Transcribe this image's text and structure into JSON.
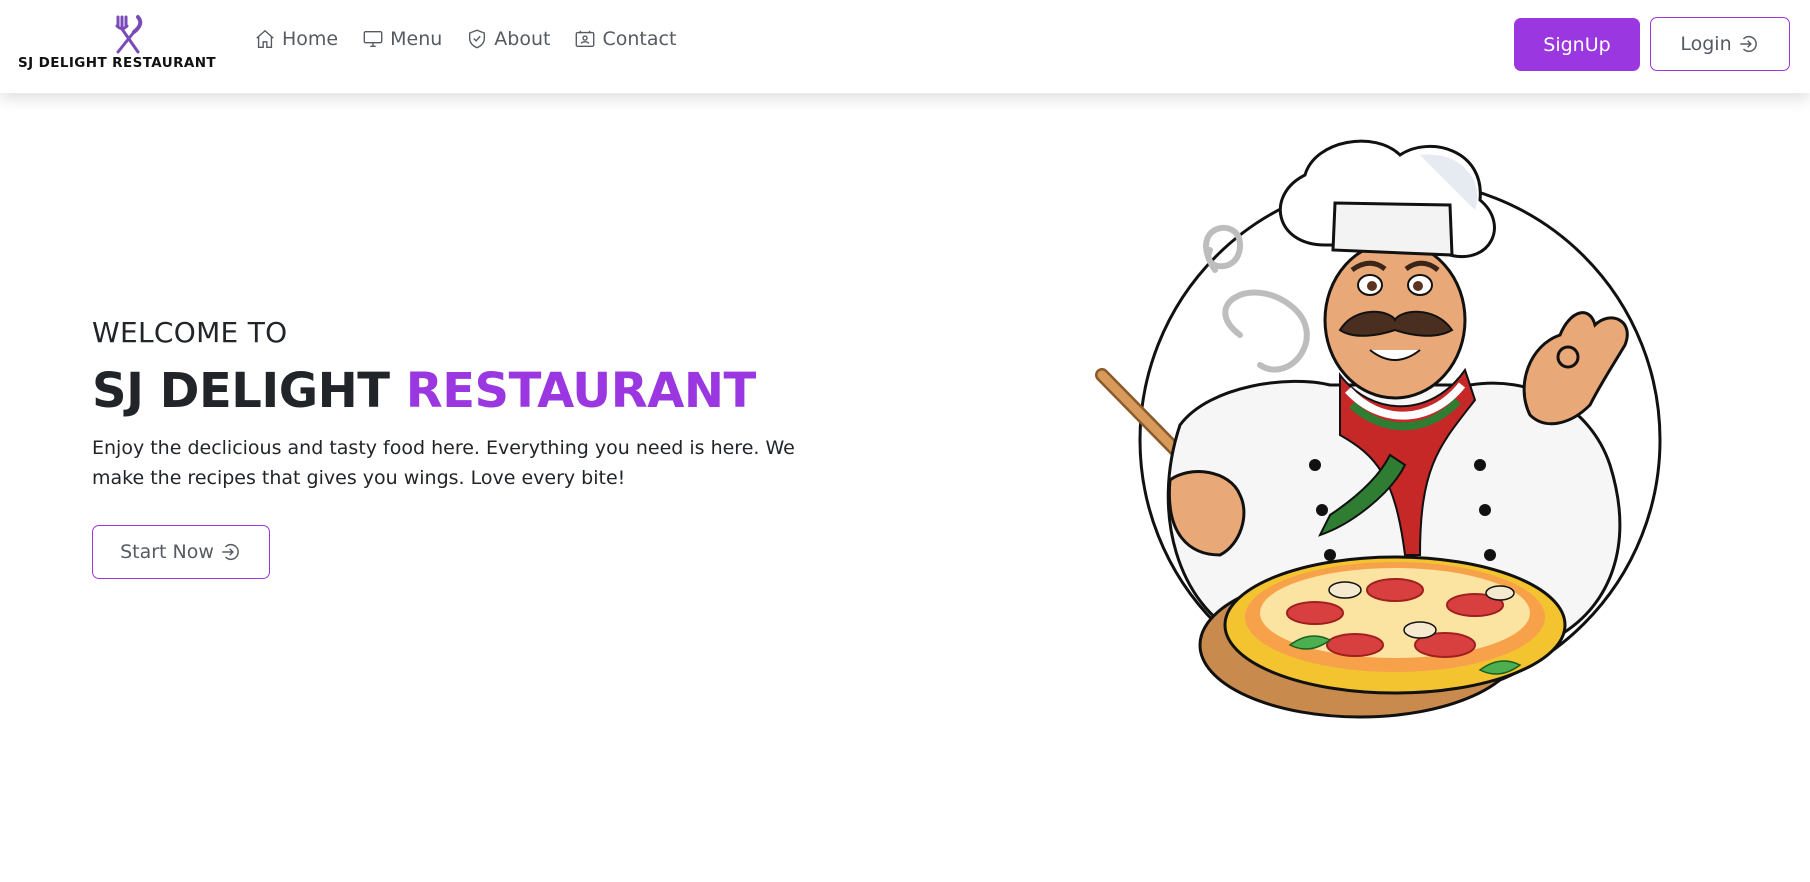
{
  "brand": {
    "name": "SJ DELIGHT RESTAURANT",
    "logo_icon": "fork-knife-icon",
    "accent_color": "#9b37e0"
  },
  "nav": {
    "items": [
      {
        "label": "Home",
        "icon": "home-icon"
      },
      {
        "label": "Menu",
        "icon": "monitor-icon"
      },
      {
        "label": "About",
        "icon": "shield-check-icon"
      },
      {
        "label": "Contact",
        "icon": "contact-card-icon"
      }
    ]
  },
  "auth": {
    "signup_label": "SignUp",
    "login_label": "Login",
    "login_icon": "sign-in-icon"
  },
  "hero": {
    "kicker": "WELCOME TO",
    "title_main": "SJ DELIGHT ",
    "title_accent": "RESTAURANT",
    "description": "Enjoy the declicious and tasty food here. Everything you need is here. We make the recipes that gives you wings. Love every bite!",
    "cta_label": "Start Now",
    "cta_icon": "sign-in-icon",
    "illustration": "chef-with-pizza-illustration"
  }
}
